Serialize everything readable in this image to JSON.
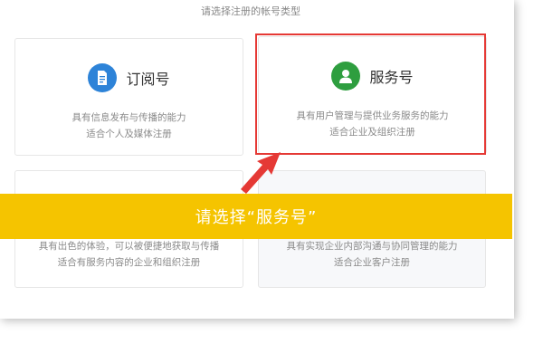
{
  "header": {
    "title": "请选择注册的帐号类型"
  },
  "cards": [
    {
      "title": "订阅号",
      "icon": "document-icon",
      "color": "#2d83d8",
      "desc1": "具有信息发布与传播的能力",
      "desc2": "适合个人及媒体注册"
    },
    {
      "title": "服务号",
      "icon": "user-icon",
      "color": "#2e9e3f",
      "desc1": "具有用户管理与提供业务服务的能力",
      "desc2": "适合企业及组织注册"
    },
    {
      "title": "",
      "icon": "",
      "color": "",
      "desc1": "具有出色的体验，可以被便捷地获取与传播",
      "desc2": "适合有服务内容的企业和组织注册"
    },
    {
      "title": "",
      "icon": "",
      "color": "",
      "desc1": "具有实现企业内部沟通与协同管理的能力",
      "desc2": "适合企业客户注册"
    }
  ],
  "banner": {
    "text": "请选择“服务号”"
  },
  "colors": {
    "highlight": "#e53935",
    "banner": "#f5c400"
  }
}
